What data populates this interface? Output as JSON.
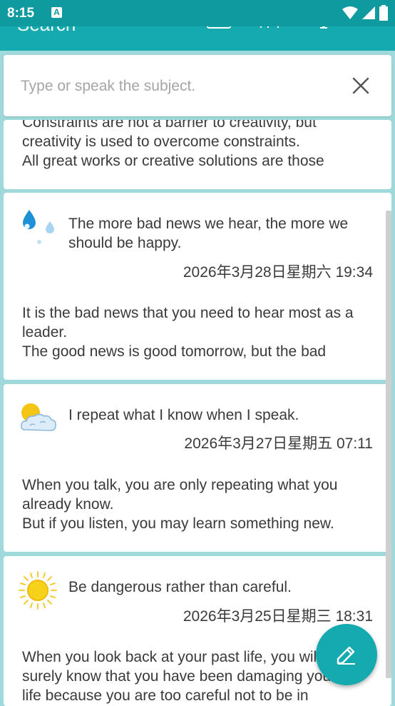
{
  "status": {
    "time": "8:15",
    "badge": "A"
  },
  "toolbar": {
    "title": "Search"
  },
  "search": {
    "placeholder": "Type or speak the subject."
  },
  "entries": [
    {
      "body": "Constraints are not a barrier to creativity, but\ncreativity is used to overcome constraints.\nAll great works or creative solutions are those"
    },
    {
      "weather": "rain-drops-icon",
      "title": "The more bad news we hear, the more we should be happy.",
      "date": "2026年3月28日星期六 19:34",
      "body": "It is the bad news that you need to hear most as a leader.\nThe good news is good tomorrow, but the bad"
    },
    {
      "weather": "partly-cloudy-icon",
      "title": "I repeat what I know when I speak.",
      "date": "2026年3月27日星期五 07:11",
      "body": "When you talk, you are only repeating what you already know.\nBut if you listen, you may learn something new."
    },
    {
      "weather": "sunny-icon",
      "title": "Be dangerous rather than careful.",
      "date": "2026年3月25日星期三 18:31",
      "body": "When you look back at your past life, you will\nsurely know that you have been damaging your\nlife because you are too careful not to be in"
    }
  ],
  "colors": {
    "primary": "#14aab0",
    "status": "#0f9aa0",
    "background": "#9fd9dc"
  }
}
